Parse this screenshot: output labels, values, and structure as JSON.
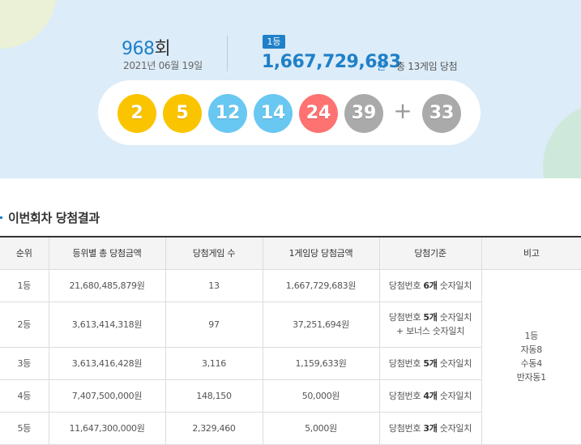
{
  "header": {
    "round_number": "968",
    "round_suffix": "회",
    "date": "2021년 06월 19일",
    "rank_badge": "1등",
    "first_prize_amount": "1,667,729,683",
    "first_prize_unit": "원",
    "first_prize_note": "총 13게임 당첨"
  },
  "balls": {
    "numbers": [
      {
        "value": "2",
        "color": "#fbc400"
      },
      {
        "value": "5",
        "color": "#fbc400"
      },
      {
        "value": "12",
        "color": "#69c8f2"
      },
      {
        "value": "14",
        "color": "#69c8f2"
      },
      {
        "value": "24",
        "color": "#ff7272"
      },
      {
        "value": "39",
        "color": "#aaaaaa"
      }
    ],
    "plus": "+",
    "bonus": {
      "value": "33",
      "color": "#aaaaaa"
    }
  },
  "section": {
    "title": "이번회차 당첨결과"
  },
  "table": {
    "headers": [
      "순위",
      "등위별 총 당첨금액",
      "당첨게임 수",
      "1게임당 당첨금액",
      "당첨기준",
      "비고"
    ],
    "rows": [
      {
        "rank": "1등",
        "total": "21,680,485,879원",
        "games": "13",
        "per_game": "1,667,729,683원",
        "criteria_pre": "당첨번호 ",
        "criteria_bold": "6개",
        "criteria_post": " 숫자일치",
        "criteria_line2": ""
      },
      {
        "rank": "2등",
        "total": "3,613,414,318원",
        "games": "97",
        "per_game": "37,251,694원",
        "criteria_pre": "당첨번호 ",
        "criteria_bold": "5개",
        "criteria_post": " 숫자일치",
        "criteria_line2": "+ 보너스 숫자일치"
      },
      {
        "rank": "3등",
        "total": "3,613,416,428원",
        "games": "3,116",
        "per_game": "1,159,633원",
        "criteria_pre": "당첨번호 ",
        "criteria_bold": "5개",
        "criteria_post": " 숫자일치",
        "criteria_line2": ""
      },
      {
        "rank": "4등",
        "total": "7,407,500,000원",
        "games": "148,150",
        "per_game": "50,000원",
        "criteria_pre": "당첨번호 ",
        "criteria_bold": "4개",
        "criteria_post": " 숫자일치",
        "criteria_line2": ""
      },
      {
        "rank": "5등",
        "total": "11,647,300,000원",
        "games": "2,329,460",
        "per_game": "5,000원",
        "criteria_pre": "당첨번호 ",
        "criteria_bold": "3개",
        "criteria_post": " 숫자일치",
        "criteria_line2": ""
      }
    ],
    "note_lines": [
      "1등",
      "자동8",
      "수동4",
      "반자동1"
    ]
  }
}
